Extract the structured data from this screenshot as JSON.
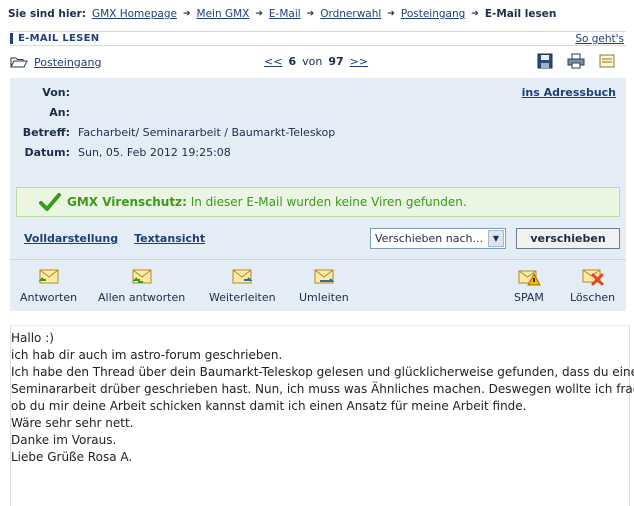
{
  "breadcrumb": {
    "prefix": "Sie sind hier:",
    "items": [
      "GMX Homepage",
      "Mein GMX",
      "E-Mail",
      "Ordnerwahl",
      "Posteingang"
    ],
    "current": "E-Mail lesen"
  },
  "header": {
    "title": "E-MAIL LESEN",
    "help": "So geht's"
  },
  "nav": {
    "folder": "Posteingang",
    "prev": "<<",
    "current_index": "6",
    "of": "von",
    "total": "97",
    "next": ">>"
  },
  "message": {
    "from_label": "Von:",
    "from_value": "",
    "to_label": "An:",
    "to_value": "",
    "subject_label": "Betreff:",
    "subject_value": "Facharbeit/ Seminararbeit / Baumarkt-Teleskop",
    "date_label": "Datum:",
    "date_value": "Sun, 05. Feb 2012 19:25:08",
    "address_book": "ins Adressbuch"
  },
  "virus": {
    "brand": "GMX Virenschutz:",
    "text": "In dieser E-Mail wurden keine Viren gefunden."
  },
  "views": {
    "full": "Volldarstellung",
    "text": "Textansicht"
  },
  "move": {
    "select_value": "Verschieben nach...",
    "button": "verschieben"
  },
  "toolbar": {
    "reply": "Antworten",
    "reply_all": "Allen antworten",
    "forward": "Weiterleiten",
    "redirect": "Umleiten",
    "spam": "SPAM",
    "delete": "Löschen"
  },
  "body": {
    "lines": [
      "Hallo :)",
      "ich hab dir auch im astro-forum geschrieben.",
      "Ich habe den Thread über dein Baumarkt-Teleskop gelesen und glücklicherweise gefunden, dass du eine",
      "Seminararbeit drüber geschrieben hast. Nun, ich muss was Ähnliches machen. Deswegen wollte ich fragen,",
      "ob du mir deine Arbeit schicken kannst damit ich einen Ansatz für meine Arbeit finde.",
      "Wäre sehr sehr nett.",
      "Danke im Voraus.",
      "Liebe Grüße Rosa A."
    ]
  },
  "colors": {
    "link": "#1f3f7a",
    "panel_bg": "#e4edf6",
    "virus_green": "#3a9a1c"
  }
}
